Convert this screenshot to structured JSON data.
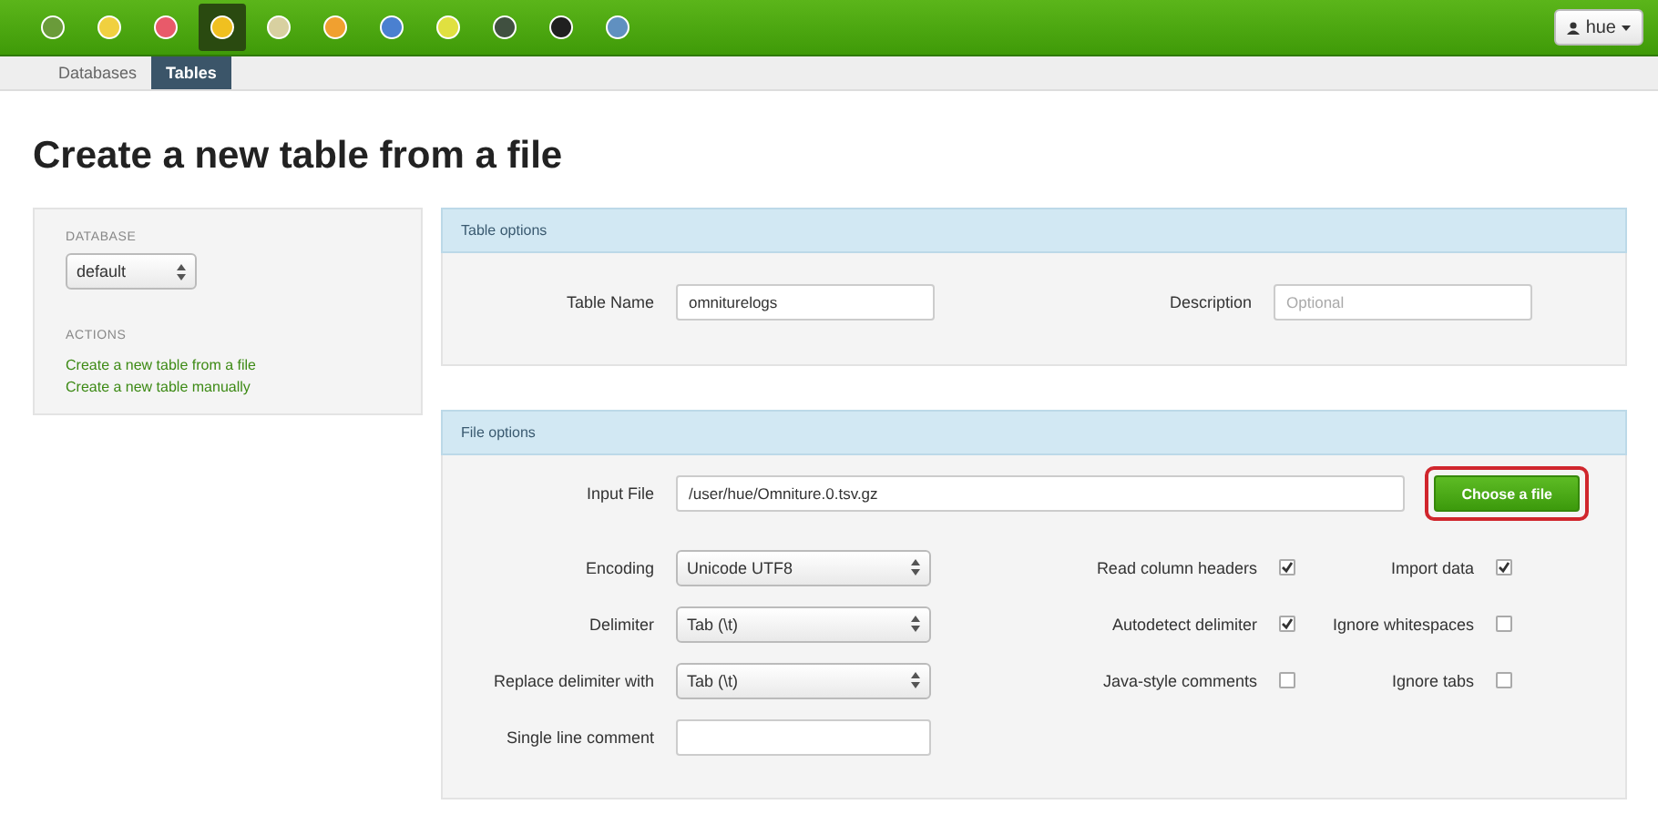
{
  "top_bar": {
    "apps": [
      {
        "selected": false
      },
      {
        "selected": false
      },
      {
        "selected": false
      },
      {
        "selected": true
      },
      {
        "selected": false
      },
      {
        "selected": false
      },
      {
        "selected": false
      },
      {
        "selected": false
      },
      {
        "selected": false
      },
      {
        "selected": false
      },
      {
        "selected": false
      }
    ],
    "user_menu": "hue"
  },
  "sub_nav": [
    {
      "label": "Databases",
      "selected": false
    },
    {
      "label": "Tables",
      "selected": true
    }
  ],
  "title": "Create a new table from a file",
  "sidebar": {
    "database_heading": "DATABASE",
    "database_select": "default",
    "actions_heading": "ACTIONS",
    "actions": [
      "Create a new table from a file",
      "Create a new table manually"
    ]
  },
  "table_options": {
    "heading": "Table options",
    "table_name_label": "Table Name",
    "table_name": "omniturelogs",
    "description_label": "Description",
    "description_placeholder": "Optional"
  },
  "file_options": {
    "heading": "File options",
    "input_file_label": "Input File",
    "input_file": "/user/hue/Omniture.0.tsv.gz",
    "choose_button": {
      "label": "Choose a file",
      "highlighted": true
    },
    "rows": [
      {
        "label": "Encoding",
        "kind": "select",
        "value": "Unicode UTF8",
        "checks": [
          {
            "label": "Read column headers",
            "checked": true
          },
          {
            "label": "Import data",
            "checked": true
          }
        ]
      },
      {
        "label": "Delimiter",
        "kind": "select",
        "value": "Tab (\\t)",
        "checks": [
          {
            "label": "Autodetect delimiter",
            "checked": true
          },
          {
            "label": "Ignore whitespaces",
            "checked": false
          }
        ]
      },
      {
        "label": "Replace delimiter with",
        "kind": "select",
        "value": "Tab (\\t)",
        "checks": [
          {
            "label": "Java-style comments",
            "checked": false
          },
          {
            "label": "Ignore tabs",
            "checked": false
          }
        ]
      },
      {
        "label": "Single line comment",
        "kind": "text",
        "value": ""
      }
    ]
  }
}
